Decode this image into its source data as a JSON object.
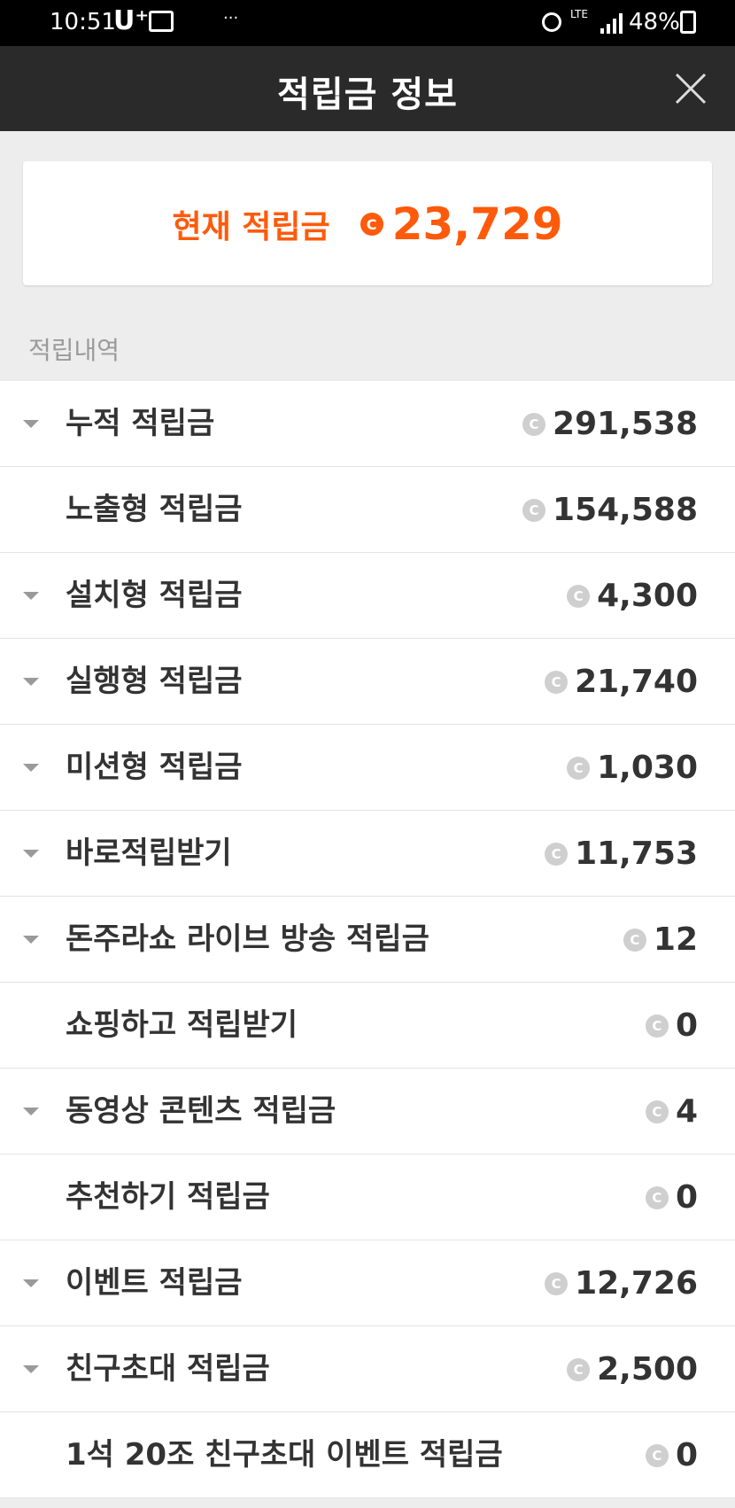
{
  "status_bar": {
    "time": "10:51",
    "carrier": "U⁺",
    "dots": "···",
    "lte": "LTE",
    "battery": "48%"
  },
  "header": {
    "title": "적립금 정보"
  },
  "balance": {
    "label": "현재 적립금",
    "coin": "C",
    "amount": "23,729"
  },
  "section_title": "적립내역",
  "rows": [
    {
      "label": "누적 적립금",
      "value": "291,538",
      "expandable": true
    },
    {
      "label": "노출형 적립금",
      "value": "154,588",
      "expandable": false
    },
    {
      "label": "설치형 적립금",
      "value": "4,300",
      "expandable": true
    },
    {
      "label": "실행형 적립금",
      "value": "21,740",
      "expandable": true
    },
    {
      "label": "미션형 적립금",
      "value": "1,030",
      "expandable": true
    },
    {
      "label": "바로적립받기",
      "value": "11,753",
      "expandable": true
    },
    {
      "label": "돈주라쇼 라이브 방송 적립금",
      "value": "12",
      "expandable": true
    },
    {
      "label": "쇼핑하고 적립받기",
      "value": "0",
      "expandable": false
    },
    {
      "label": "동영상 콘텐츠 적립금",
      "value": "4",
      "expandable": true
    },
    {
      "label": "추천하기 적립금",
      "value": "0",
      "expandable": false
    },
    {
      "label": "이벤트 적립금",
      "value": "12,726",
      "expandable": true
    },
    {
      "label": "친구초대 적립금",
      "value": "2,500",
      "expandable": true
    },
    {
      "label": "1석 20조 친구초대 이벤트 적립금",
      "value": "0",
      "expandable": false
    }
  ],
  "coin_symbol": "C",
  "colors": {
    "accent": "#ff5a0a",
    "header_bg": "#2a2a2a",
    "page_bg": "#ededed"
  }
}
